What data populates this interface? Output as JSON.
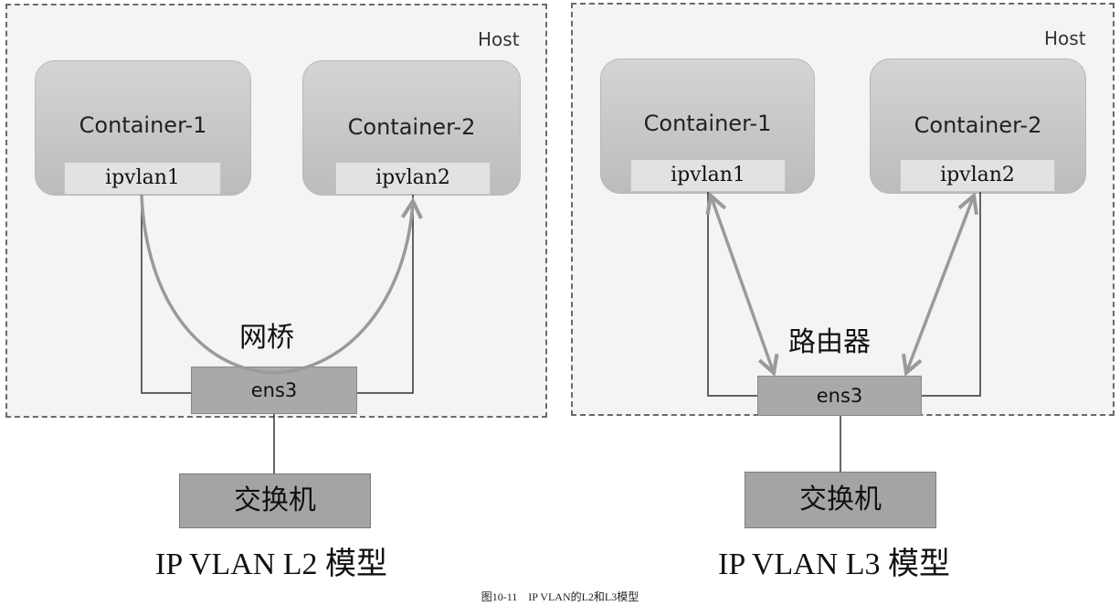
{
  "left": {
    "host_label": "Host",
    "container1": {
      "title": "Container-1",
      "iface": "ipvlan1"
    },
    "container2": {
      "title": "Container-2",
      "iface": "ipvlan2"
    },
    "mid_label": "网桥",
    "ens": "ens3",
    "switch": "交换机",
    "model_title": "IP VLAN L2 模型"
  },
  "right": {
    "host_label": "Host",
    "container1": {
      "title": "Container-1",
      "iface": "ipvlan1"
    },
    "container2": {
      "title": "Container-2",
      "iface": "ipvlan2"
    },
    "mid_label": "路由器",
    "ens": "ens3",
    "switch": "交换机",
    "model_title": "IP VLAN L3 模型"
  },
  "caption": "图10-11　IP VLAN的L2和L3模型",
  "colors": {
    "arrow": "#9a9a9a",
    "line": "#333333",
    "host_border": "#6a6a6a"
  }
}
